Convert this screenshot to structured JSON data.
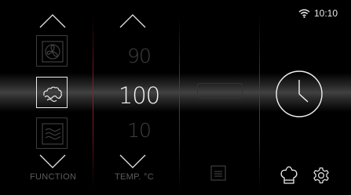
{
  "status_bar": {
    "time": "10:10",
    "wifi_icon": "wifi-icon"
  },
  "function_column": {
    "label": "FUNCTION",
    "items": [
      {
        "name": "fan-heat",
        "icon": "fan-icon",
        "state": "dim"
      },
      {
        "name": "steam",
        "icon": "steam-cloud-icon",
        "state": "selected"
      },
      {
        "name": "low-steam",
        "icon": "wave-lines-icon",
        "state": "dim"
      }
    ]
  },
  "temperature_column": {
    "label": "TEMP. °C",
    "values": [
      {
        "text": "90",
        "state": "dim"
      },
      {
        "text": "100",
        "state": "selected"
      },
      {
        "text": "10",
        "state": "dim"
      }
    ]
  },
  "actions": {
    "timer_icon": "clock-icon",
    "recipes_icon": "chef-hat-icon",
    "settings_icon": "gear-icon",
    "menu_icon": "document-lines-icon"
  },
  "colors": {
    "background": "#000000",
    "divider": "#8c1f1f",
    "active_text": "#f4f4f4",
    "dim_text": "#3f3f3f"
  }
}
